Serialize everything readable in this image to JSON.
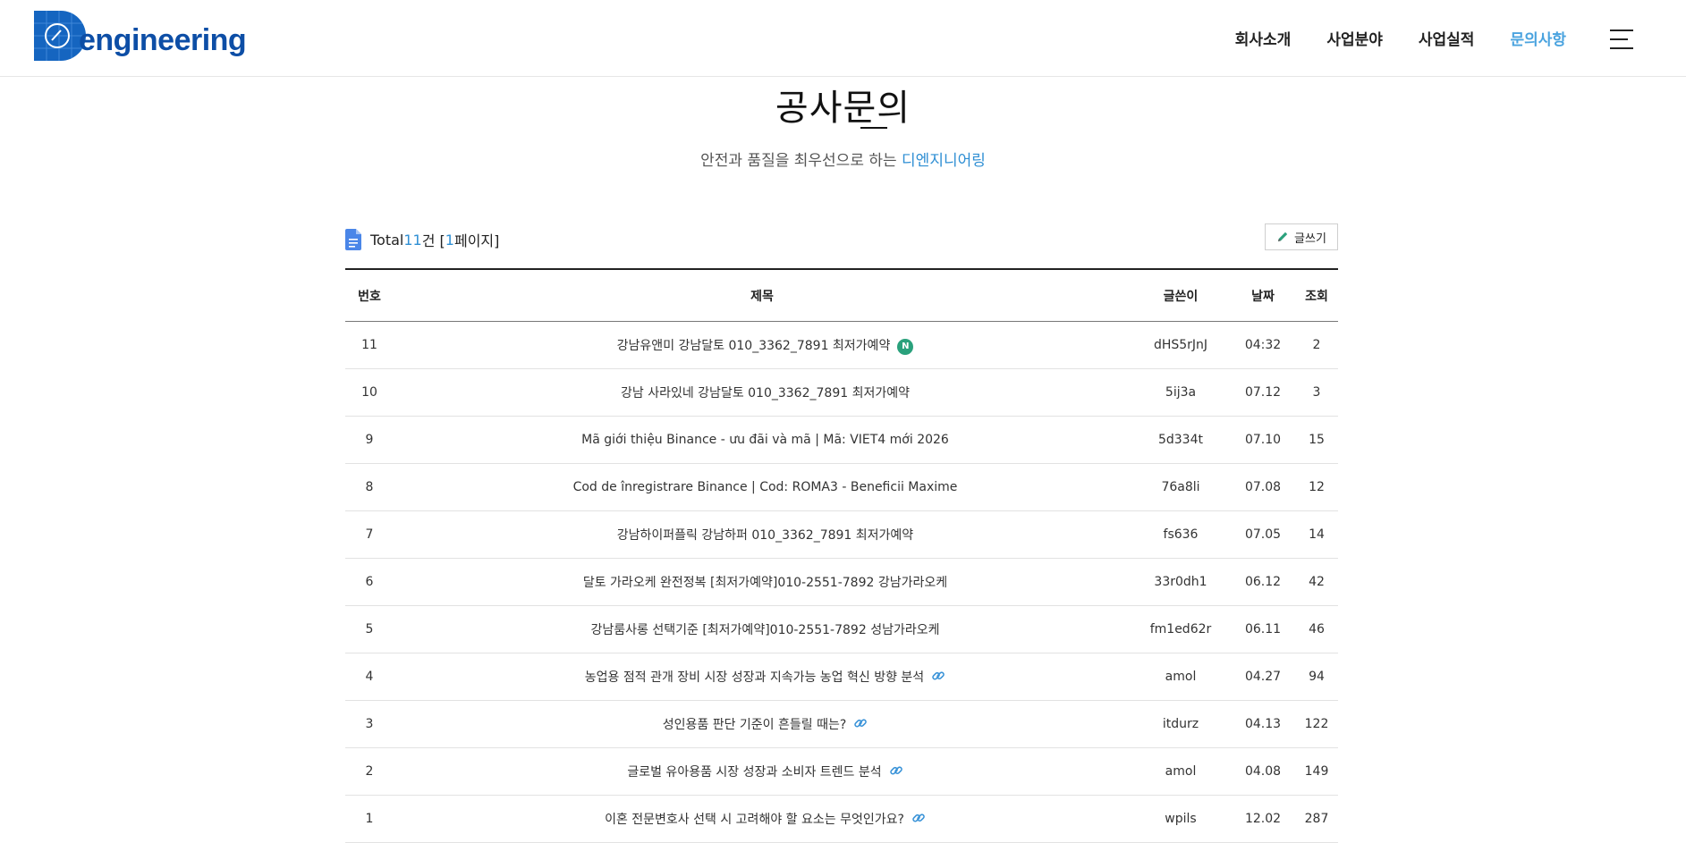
{
  "header": {
    "logo_text": "engineering",
    "nav": [
      {
        "label": "회사소개",
        "active": false
      },
      {
        "label": "사업분야",
        "active": false
      },
      {
        "label": "사업실적",
        "active": false
      },
      {
        "label": "문의사항",
        "active": true
      }
    ]
  },
  "page": {
    "title": "공사문의",
    "subtitle_prefix": "안전과 품질을 최우선으로 하는 ",
    "subtitle_brand": "디엔지니어링"
  },
  "board": {
    "total_label": "Total ",
    "total_count": "11",
    "total_unit": "건 [",
    "page_count": "1",
    "page_unit": " 페이지]",
    "write_button": "글쓰기",
    "columns": {
      "num": "번호",
      "subject": "제목",
      "writer": "글쓴이",
      "date": "날짜",
      "hits": "조회"
    },
    "rows": [
      {
        "num": "11",
        "subject": "강남유앤미 강남달토 010_3362_7891 최저가예약",
        "writer": "dHS5rJnJ",
        "date": "04:32",
        "hits": "2",
        "badge": "N",
        "link": false
      },
      {
        "num": "10",
        "subject": "강남 사라있네 강남달토 010_3362_7891 최저가예약",
        "writer": "5ij3a",
        "date": "07.12",
        "hits": "3",
        "badge": "",
        "link": false
      },
      {
        "num": "9",
        "subject": "Mã giới thiệu Binance - ưu đãi và mã | Mã: VIET4 mới 2026",
        "writer": "5d334t",
        "date": "07.10",
        "hits": "15",
        "badge": "",
        "link": false
      },
      {
        "num": "8",
        "subject": "Cod de înregistrare Binance | Cod: ROMA3 - Beneficii Maxime",
        "writer": "76a8li",
        "date": "07.08",
        "hits": "12",
        "badge": "",
        "link": false
      },
      {
        "num": "7",
        "subject": "강남하이퍼플릭 강남하퍼 010_3362_7891 최저가예약",
        "writer": "fs636",
        "date": "07.05",
        "hits": "14",
        "badge": "",
        "link": false
      },
      {
        "num": "6",
        "subject": "달토 가라오케 완전정복 [최저가예약]010-2551-7892 강남가라오케",
        "writer": "33r0dh1",
        "date": "06.12",
        "hits": "42",
        "badge": "",
        "link": false
      },
      {
        "num": "5",
        "subject": "강남룸사롱 선택기준 [최저가예약]010-2551-7892 성남가라오케",
        "writer": "fm1ed62r",
        "date": "06.11",
        "hits": "46",
        "badge": "",
        "link": false
      },
      {
        "num": "4",
        "subject": "농업용 점적 관개 장비 시장 성장과 지속가능 농업 혁신 방향 분석",
        "writer": "amol",
        "date": "04.27",
        "hits": "94",
        "badge": "",
        "link": true
      },
      {
        "num": "3",
        "subject": "성인용품 판단 기준이 흔들릴 때는?",
        "writer": "itdurz",
        "date": "04.13",
        "hits": "122",
        "badge": "",
        "link": true
      },
      {
        "num": "2",
        "subject": "글로벌 유아용품 시장 성장과 소비자 트렌드 분석",
        "writer": "amol",
        "date": "04.08",
        "hits": "149",
        "badge": "",
        "link": true
      },
      {
        "num": "1",
        "subject": "이혼 전문변호사 선택 시 고려해야 할 요소는 무엇인가요?",
        "writer": "wpils",
        "date": "12.02",
        "hits": "287",
        "badge": "",
        "link": true
      }
    ]
  },
  "colors": {
    "accent": "#2f8fd4",
    "brand_blue": "#0d4ea6",
    "new_badge": "#2aa17c"
  },
  "icons": {
    "doc": "document-icon",
    "pencil": "pencil-icon",
    "link": "link-icon",
    "menu": "hamburger-menu-icon"
  }
}
